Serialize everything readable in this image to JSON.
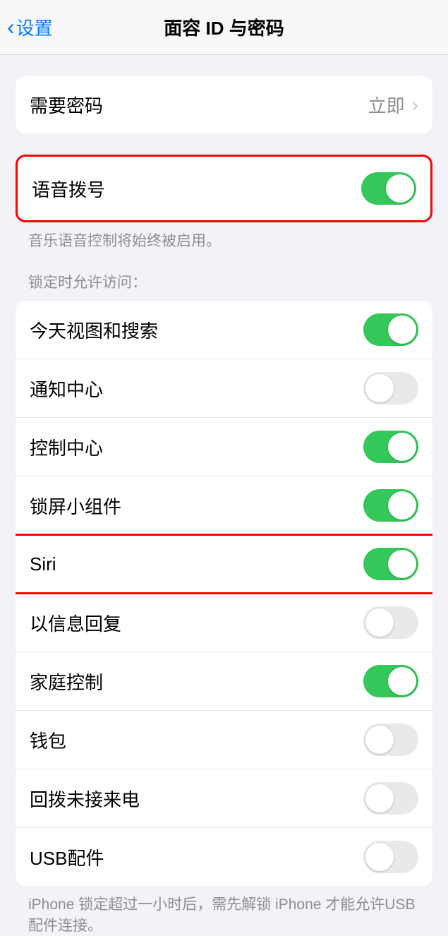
{
  "header": {
    "back_label": "设置",
    "title": "面容 ID 与密码"
  },
  "passcode": {
    "label": "需要密码",
    "value": "立即"
  },
  "voice_dial": {
    "label": "语音拨号",
    "enabled": true,
    "footer": "音乐语音控制将始终被启用。"
  },
  "locked_access": {
    "header": "锁定时允许访问：",
    "items": [
      {
        "label": "今天视图和搜索",
        "enabled": true
      },
      {
        "label": "通知中心",
        "enabled": false
      },
      {
        "label": "控制中心",
        "enabled": true
      },
      {
        "label": "锁屏小组件",
        "enabled": true
      },
      {
        "label": "Siri",
        "enabled": true
      },
      {
        "label": "以信息回复",
        "enabled": false
      },
      {
        "label": "家庭控制",
        "enabled": true
      },
      {
        "label": "钱包",
        "enabled": false
      },
      {
        "label": "回拨未接来电",
        "enabled": false
      },
      {
        "label": "USB配件",
        "enabled": false
      }
    ],
    "footer": "iPhone 锁定超过一小时后，需先解锁 iPhone 才能允许USB 配件连接。"
  }
}
